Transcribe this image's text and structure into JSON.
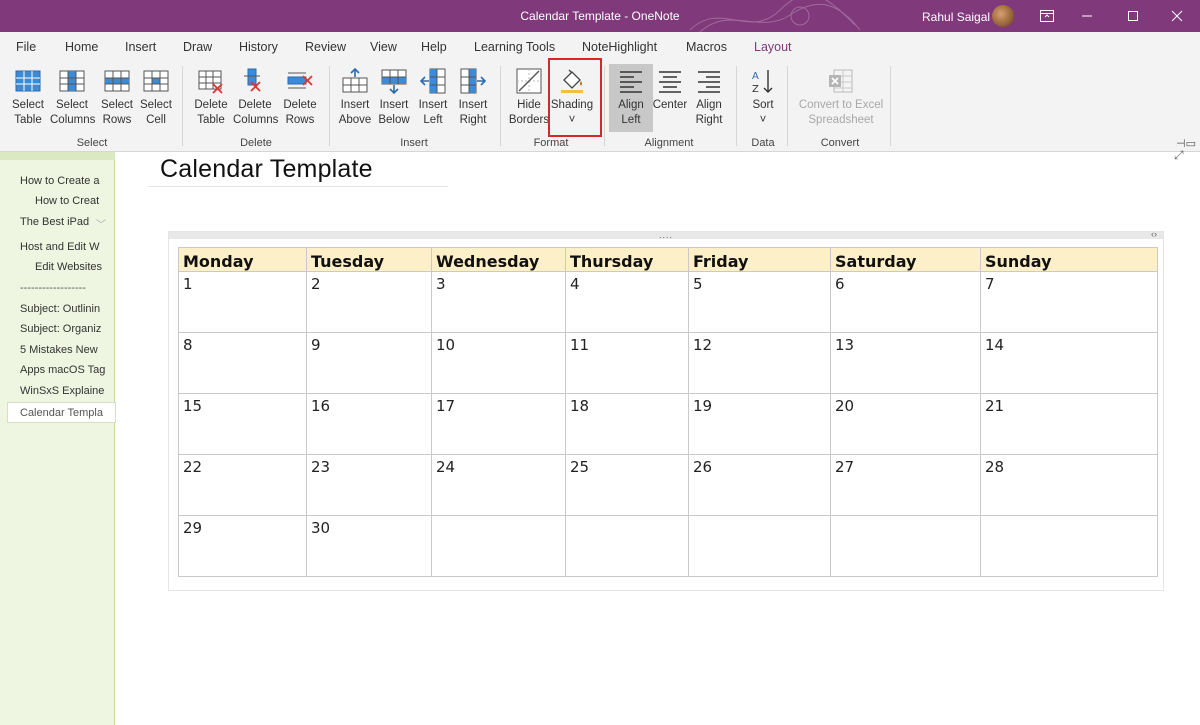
{
  "window": {
    "title": "Calendar Template  -  OneNote",
    "user": "Rahul Saigal",
    "colors": {
      "accent": "#80397b",
      "highlight": "#d22a2a",
      "sidebar": "#eef5e0",
      "header_fill": "#fdefc8"
    }
  },
  "tabs": [
    "File",
    "Home",
    "Insert",
    "Draw",
    "History",
    "Review",
    "View",
    "Help",
    "Learning Tools",
    "NoteHighlight",
    "Macros",
    "Layout"
  ],
  "active_tab": "Layout",
  "ribbon": {
    "select_table": [
      "Select",
      "Table"
    ],
    "select_columns": [
      "Select",
      "Columns"
    ],
    "select_rows": [
      "Select",
      "Rows"
    ],
    "select_cell": [
      "Select",
      "Cell"
    ],
    "delete_table": [
      "Delete",
      "Table"
    ],
    "delete_columns": [
      "Delete",
      "Columns"
    ],
    "delete_rows": [
      "Delete",
      "Rows"
    ],
    "insert_above": [
      "Insert",
      "Above"
    ],
    "insert_below": [
      "Insert",
      "Below"
    ],
    "insert_left": [
      "Insert",
      "Left"
    ],
    "insert_right": [
      "Insert",
      "Right"
    ],
    "hide_borders": [
      "Hide",
      "Borders"
    ],
    "shading": [
      "Shading",
      "˅"
    ],
    "align_left": [
      "Align",
      "Left"
    ],
    "center": [
      "Center",
      ""
    ],
    "align_right": [
      "Align",
      "Right"
    ],
    "sort": [
      "Sort",
      "˅"
    ],
    "convert_excel": [
      "Convert to Excel",
      "Spreadsheet"
    ],
    "groups": {
      "select": "Select",
      "delete": "Delete",
      "insert": "Insert",
      "format": "Format",
      "alignment": "Alignment",
      "data": "Data",
      "convert": "Convert"
    }
  },
  "sidebar": {
    "pages": [
      {
        "label": "How to Create a",
        "level": 0
      },
      {
        "label": "How to Creat",
        "level": 1
      },
      {
        "label": "The Best iPad",
        "level": 0
      },
      {
        "label": "Host and Edit W",
        "level": 0
      },
      {
        "label": "Edit Websites",
        "level": 1
      },
      {
        "label": "------------------",
        "level": 0
      },
      {
        "label": "Subject: Outlinin",
        "level": 0
      },
      {
        "label": "Subject: Organiz",
        "level": 0
      },
      {
        "label": "5 Mistakes New",
        "level": 0
      },
      {
        "label": "Apps macOS Tag",
        "level": 0
      },
      {
        "label": "WinSxS Explaine",
        "level": 0
      },
      {
        "label": "Calendar Templa",
        "level": 0,
        "active": true
      }
    ]
  },
  "page": {
    "title": "Calendar Template",
    "handle_dots": "....",
    "handle_arrows": "‹›",
    "calendar": {
      "days": [
        "Monday",
        "Tuesday",
        "Wednesday",
        "Thursday",
        "Friday",
        "Saturday",
        "Sunday"
      ],
      "rows": [
        [
          "1",
          "2",
          "3",
          "4",
          "5",
          "6",
          "7"
        ],
        [
          "8",
          "9",
          "10",
          "11",
          "12",
          "13",
          "14"
        ],
        [
          "15",
          "16",
          "17",
          "18",
          "19",
          "20",
          "21"
        ],
        [
          "22",
          "23",
          "24",
          "25",
          "26",
          "27",
          "28"
        ],
        [
          "29",
          "30",
          "",
          "",
          "",
          "",
          ""
        ]
      ]
    }
  }
}
